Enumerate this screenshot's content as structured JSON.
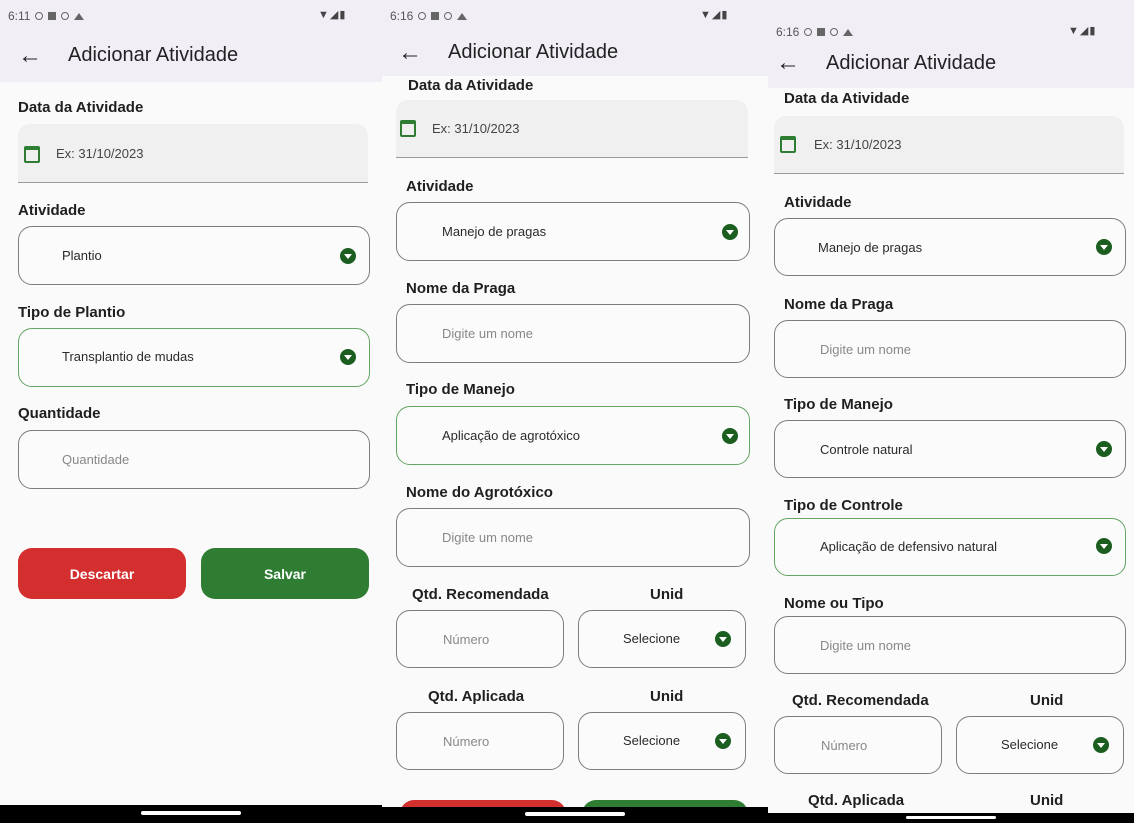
{
  "screen1": {
    "time": "6:11",
    "header_title": "Adicionar Atividade",
    "date_label": "Data da Atividade",
    "date_placeholder": "Ex: 31/10/2023",
    "atividade_label": "Atividade",
    "atividade_value": "Plantio",
    "tipo_plantio_label": "Tipo de Plantio",
    "tipo_plantio_value": "Transplantio de mudas",
    "quantidade_label": "Quantidade",
    "quantidade_placeholder": "Quantidade",
    "discard_label": "Descartar",
    "save_label": "Salvar"
  },
  "screen2": {
    "time": "6:16",
    "header_title": "Adicionar Atividade",
    "date_label": "Data da Atividade",
    "date_placeholder": "Ex: 31/10/2023",
    "atividade_label": "Atividade",
    "atividade_value": "Manejo de pragas",
    "nome_praga_label": "Nome da Praga",
    "nome_praga_placeholder": "Digite um nome",
    "tipo_manejo_label": "Tipo de Manejo",
    "tipo_manejo_value": "Aplicação de agrotóxico",
    "nome_agrotoxico_label": "Nome do Agrotóxico",
    "nome_agrotoxico_placeholder": "Digite um nome",
    "qtd_recomendada_label": "Qtd. Recomendada",
    "unid_label_1": "Unid",
    "numero_placeholder_1": "Número",
    "selecione_1": "Selecione",
    "qtd_aplicada_label": "Qtd. Aplicada",
    "unid_label_2": "Unid",
    "numero_placeholder_2": "Número",
    "selecione_2": "Selecione"
  },
  "screen3": {
    "time": "6:16",
    "header_title": "Adicionar Atividade",
    "date_label": "Data da Atividade",
    "date_placeholder": "Ex: 31/10/2023",
    "atividade_label": "Atividade",
    "atividade_value": "Manejo de pragas",
    "nome_praga_label": "Nome da Praga",
    "nome_praga_placeholder": "Digite um nome",
    "tipo_manejo_label": "Tipo de Manejo",
    "tipo_manejo_value": "Controle natural",
    "tipo_controle_label": "Tipo de Controle",
    "tipo_controle_value": "Aplicação de defensivo natural",
    "nome_tipo_label": "Nome ou Tipo",
    "nome_tipo_placeholder": "Digite um nome",
    "qtd_recomendada_label": "Qtd. Recomendada",
    "unid_label_1": "Unid",
    "numero_placeholder": "Número",
    "selecione": "Selecione",
    "qtd_aplicada_label": "Qtd. Aplicada",
    "unid_label_2": "Unid"
  },
  "colors": {
    "accent_green": "#2e7d32",
    "discard_red": "#d32f2f",
    "appbar_bg": "#f2eef6"
  },
  "icons": [
    "back-arrow-icon",
    "calendar-icon",
    "dropdown-icon",
    "wifi-icon",
    "signal-icon",
    "battery-icon"
  ]
}
